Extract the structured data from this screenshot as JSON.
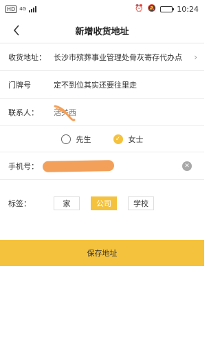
{
  "status_bar": {
    "sim_label": "HD",
    "network": "4G",
    "time": "10:24"
  },
  "nav": {
    "title": "新增收货地址"
  },
  "form": {
    "address": {
      "label": "收货地址：",
      "value": "长沙市殡葬事业管理处骨灰寄存代办点"
    },
    "door": {
      "label": "门牌号",
      "value": "定不到位其实还要往里走"
    },
    "contact": {
      "label": "联系人：",
      "value": "活关西"
    },
    "gender": {
      "male": "先生",
      "female": "女士",
      "selected": "female"
    },
    "phone": {
      "label": "手机号："
    },
    "tags": {
      "label": "标签：",
      "options": [
        "家",
        "公司",
        "学校"
      ],
      "selected": "公司"
    }
  },
  "save_button": {
    "label": "保存地址"
  },
  "colors": {
    "accent": "#f5c23d",
    "redaction": "#f2a05a"
  }
}
